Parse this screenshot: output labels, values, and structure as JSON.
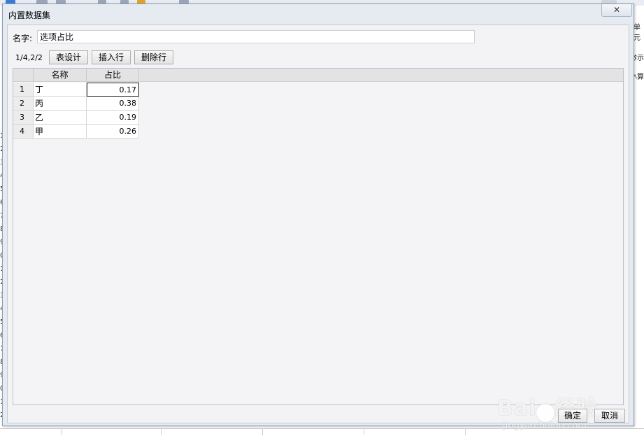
{
  "background": {
    "row_numbers": [
      "1",
      "2",
      "3",
      "4",
      "5",
      "6",
      "7",
      "8",
      "9",
      "0",
      "1",
      "2",
      "3",
      "4",
      "5",
      "6",
      "7",
      "8",
      "9",
      "0",
      "1",
      "2"
    ],
    "right_fragments": [
      "单元",
      "ﾀ示",
      "ﾍ算"
    ]
  },
  "dialog": {
    "title": "内置数据集",
    "close_glyph": "✕",
    "name_label": "名字:",
    "name_value": "选项占比",
    "page_info": "1/4,2/2",
    "buttons": {
      "table_design": "表设计",
      "insert_row": "插入行",
      "delete_row": "删除行"
    },
    "table": {
      "columns": [
        "名称",
        "占比"
      ],
      "rows": [
        {
          "num": "1",
          "name": "丁",
          "value": "0.17"
        },
        {
          "num": "2",
          "name": "丙",
          "value": "0.38"
        },
        {
          "num": "3",
          "name": "乙",
          "value": "0.19"
        },
        {
          "num": "4",
          "name": "甲",
          "value": "0.26"
        }
      ]
    },
    "ok_label": "确定",
    "cancel_label": "取消"
  },
  "watermark": {
    "brand": "Bai",
    "brand_tail": "经验",
    "url": "jingyan.baidu.com"
  }
}
